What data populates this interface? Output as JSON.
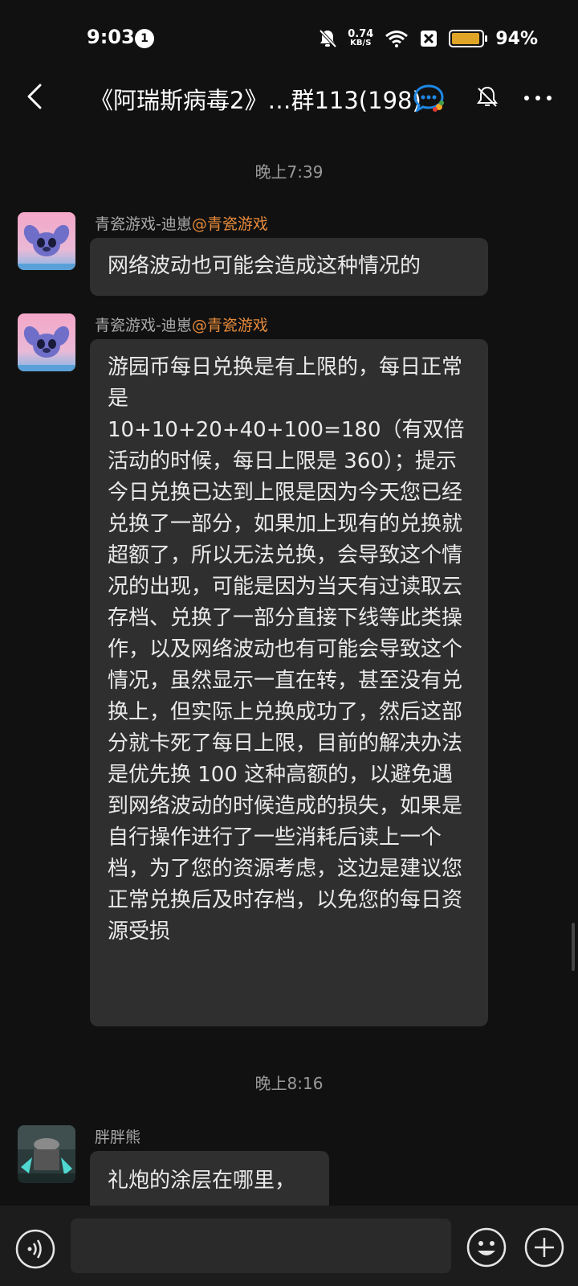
{
  "status_bar": {
    "time": "9:03",
    "notification_count": "1",
    "net_speed_value": "0.74",
    "net_speed_unit": "KB/S",
    "battery_percent": "94%",
    "battery_level": 0.94,
    "battery_color": "#e0a526"
  },
  "header": {
    "title": "《阿瑞斯病毒2》…群113(198)",
    "back_icon": "chevron-left-icon",
    "badge_icon": "group-chat-icon",
    "mute_icon": "bell-off-icon",
    "more_icon": "more-horizontal-icon"
  },
  "timestamps": [
    "晚上7:39",
    "晚上8:16"
  ],
  "messages": [
    {
      "sender": "青瓷游戏-迪崽",
      "role": "@青瓷游戏",
      "text": "网络波动也可能会造成这种情况的"
    },
    {
      "sender": "青瓷游戏-迪崽",
      "role": "@青瓷游戏",
      "text": "游园币每日兑换是有上限的，每日正常是\n10+10+20+40+100=180（有双倍活动的时候，每日上限是 360）；提示今日兑换已达到上限是因为今天您已经兑换了一部分，如果加上现有的兑换就超额了，所以无法兑换，会导致这个情况的出现，可能是因为当天有过读取云存档、兑换了一部分直接下线等此类操作，以及网络波动也有可能会导致这个情况，虽然显示一直在转，甚至没有兑换上，但实际上兑换成功了，然后这部分就卡死了每日上限，目前的解决办法是优先换 100 这种高额的，以避免遇到网络波动的时候造成的损失，如果是自行操作进行了一些消耗后读上一个档，为了您的资源考虑，这边是建议您正常兑换后及时存档，以免您的每日资源受损"
    },
    {
      "sender": "胖胖熊",
      "role": "",
      "text": "礼炮的涂层在哪里，"
    }
  ],
  "input_bar": {
    "placeholder": "",
    "voice_icon": "voice-icon",
    "emoji_icon": "emoji-icon",
    "plus_icon": "plus-icon"
  },
  "colors": {
    "background": "#111111",
    "bubble": "#2f2f2f",
    "role_tag": "#e58a3b",
    "accent_blue": "#1e88e5"
  }
}
